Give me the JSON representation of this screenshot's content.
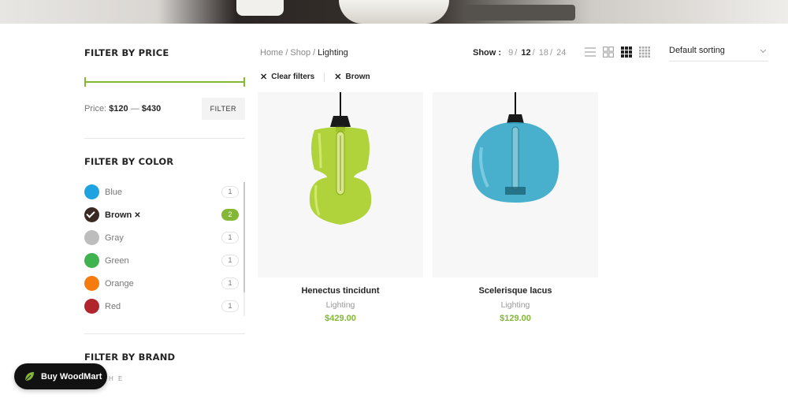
{
  "sidebar": {
    "price": {
      "title": "FILTER BY PRICE",
      "label": "Price:",
      "min": "$120",
      "sep": "—",
      "max": "$430",
      "button": "FILTER"
    },
    "color": {
      "title": "FILTER BY COLOR",
      "items": [
        {
          "name": "Blue",
          "count": "1",
          "color": "#1fa2e0"
        },
        {
          "name": "Brown",
          "count": "2",
          "color": "#3a2823",
          "active": true
        },
        {
          "name": "Gray",
          "count": "1",
          "color": "#bdbdbd"
        },
        {
          "name": "Green",
          "count": "1",
          "color": "#3fb34f"
        },
        {
          "name": "Orange",
          "count": "1",
          "color": "#f57b0f"
        },
        {
          "name": "Red",
          "count": "1",
          "color": "#b1262c"
        }
      ]
    },
    "brand": {
      "title": "FILTER BY BRAND"
    }
  },
  "breadcrumb": {
    "home": "Home",
    "shop": "Shop",
    "current": "Lighting"
  },
  "show": {
    "label": "Show :",
    "options": [
      "9",
      "12",
      "18",
      "24"
    ],
    "selected": "12"
  },
  "sorting": {
    "value": "Default sorting"
  },
  "active_filters": {
    "clear": "Clear filters",
    "brown": "Brown"
  },
  "products": [
    {
      "name": "Henectus tincidunt",
      "category": "Lighting",
      "price": "$429.00"
    },
    {
      "name": "Scelerisque lacus",
      "category": "Lighting",
      "price": "$129.00"
    }
  ],
  "buy": {
    "label": "Buy WoodMart"
  },
  "colors": {
    "accent": "#83b735",
    "text": "#242424",
    "muted": "#777777"
  }
}
